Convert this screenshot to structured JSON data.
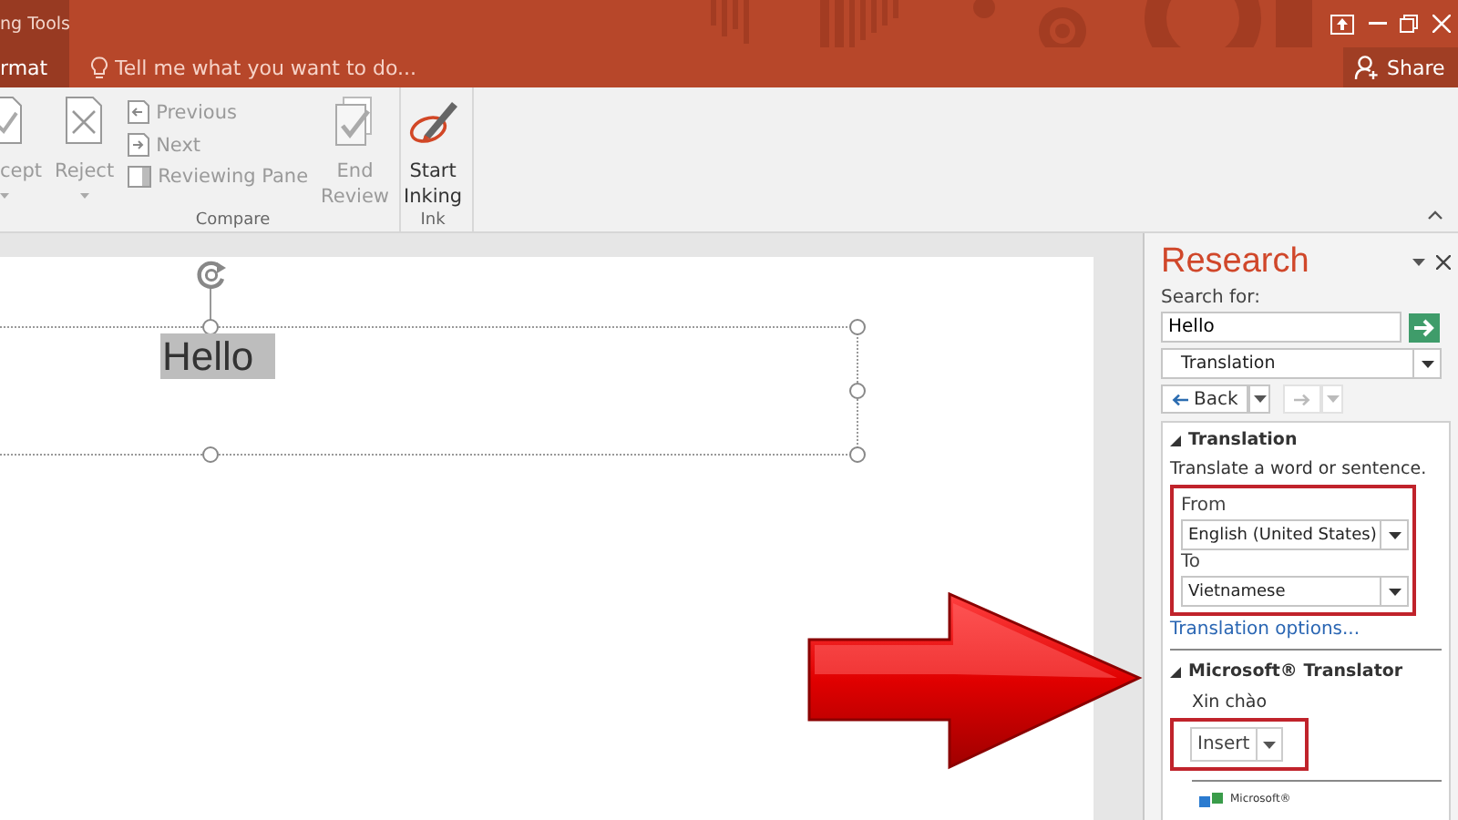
{
  "title_bar": {
    "context_label": "ng Tools"
  },
  "tabs": [
    {
      "label": "rmat",
      "selected": true
    }
  ],
  "tell_me": {
    "placeholder": "Tell me what you want to do..."
  },
  "share": {
    "label": "Share"
  },
  "ribbon": {
    "groups": [
      {
        "label": "Compare",
        "items": [
          {
            "kind": "large",
            "label": "cept",
            "disabled": true,
            "dropdown": true
          },
          {
            "kind": "large",
            "label": "Reject",
            "disabled": true,
            "dropdown": true
          },
          {
            "kind": "stack",
            "items": [
              {
                "label": "Previous",
                "disabled": true
              },
              {
                "label": "Next",
                "disabled": true
              },
              {
                "label": "Reviewing Pane",
                "disabled": true
              }
            ]
          },
          {
            "kind": "large",
            "label": "End Review",
            "disabled": true,
            "dropdown": false
          }
        ]
      },
      {
        "label": "Ink",
        "items": [
          {
            "kind": "large",
            "label": "Start Inking",
            "disabled": false,
            "dropdown": false
          }
        ]
      }
    ]
  },
  "slide": {
    "text_box": {
      "text": "Hello",
      "selected": true
    }
  },
  "research": {
    "title": "Research",
    "search_label": "Search for:",
    "search_value": "Hello",
    "service": "Translation",
    "back": "Back",
    "forward_disabled": true,
    "translation": {
      "header": "Translation",
      "description": "Translate a word or sentence.",
      "from_label": "From",
      "from_value": "English (United States)",
      "to_label": "To",
      "to_value": "Vietnamese",
      "highlighted": true,
      "options_link": "Translation options..."
    },
    "translator": {
      "header": "Microsoft® Translator",
      "result": "Xin chào",
      "insert": "Insert",
      "highlighted": true,
      "logo_text": "Microsoft®"
    }
  }
}
